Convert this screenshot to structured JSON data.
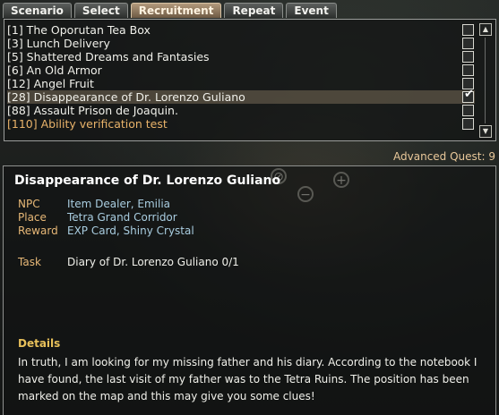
{
  "tabs": [
    {
      "label": "Scenario",
      "active": false
    },
    {
      "label": "Select",
      "active": false
    },
    {
      "label": "Recruitment",
      "active": true
    },
    {
      "label": "Repeat",
      "active": false
    },
    {
      "label": "Event",
      "active": false
    }
  ],
  "quests": [
    {
      "label": "[1] The Oporutan Tea Box",
      "checked": false
    },
    {
      "label": "[3] Lunch Delivery",
      "checked": false
    },
    {
      "label": "[5] Shattered Dreams and Fantasies",
      "checked": false
    },
    {
      "label": "[6] An Old Armor",
      "checked": false
    },
    {
      "label": "[12] Angel Fruit",
      "checked": false
    },
    {
      "label": "[28] Disappearance of Dr. Lorenzo Guliano",
      "checked": true,
      "selected": true
    },
    {
      "label": "[88] Assault Prison de Joaquin.",
      "checked": false
    },
    {
      "label": "[110] Ability verification test",
      "checked": false,
      "highlight": true
    }
  ],
  "advanced_quest": "Advanced Quest: 9",
  "detail": {
    "title": "Disappearance of Dr. Lorenzo Guliano",
    "npc_label": "NPC",
    "npc": "Item Dealer, Emilia",
    "place_label": "Place",
    "place": "Tetra Grand Corridor",
    "reward_label": "Reward",
    "reward": "EXP Card, Shiny Crystal",
    "task_label": "Task",
    "task": "Diary of Dr. Lorenzo Guliano 0/1",
    "details_label": "Details",
    "details_text": "In truth, I am looking for my missing father and his diary. According to the notebook I have found, the last visit of my father was to the Tetra Ruins. The position has been marked on the map and this may give you some clues!"
  },
  "colors": {
    "accent_orange": "#e7b877",
    "value_blue": "#a9cde0",
    "details_gold": "#e7c05a",
    "active_tab": "#b39a7c"
  }
}
